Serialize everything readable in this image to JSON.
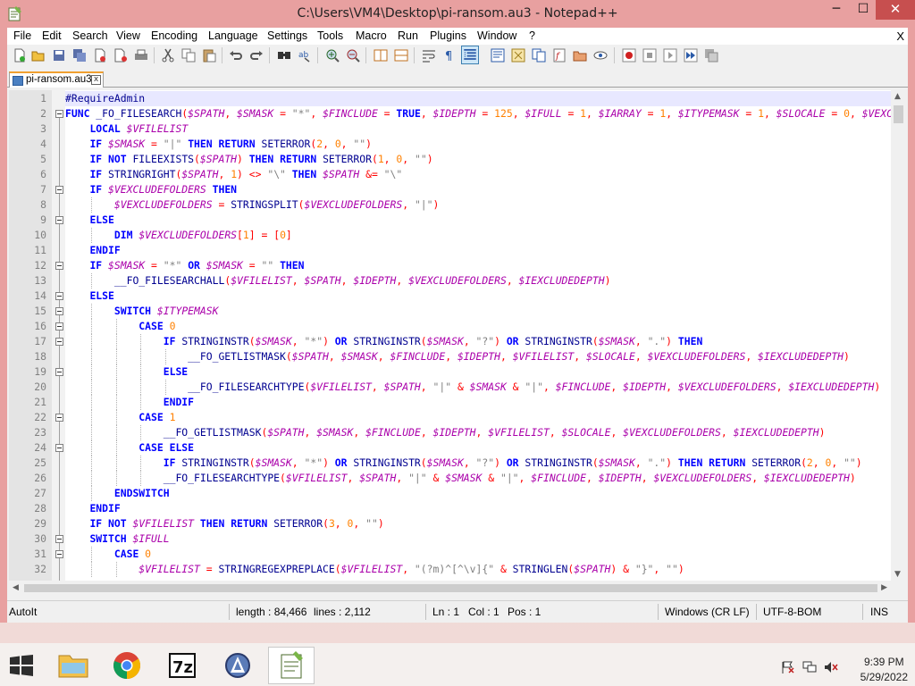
{
  "window": {
    "title": "C:\\Users\\VM4\\Desktop\\pi-ransom.au3 - Notepad++",
    "minimize": "─",
    "maximize": "☐",
    "close": "✕"
  },
  "menu": {
    "items": [
      "File",
      "Edit",
      "Search",
      "View",
      "Encoding",
      "Language",
      "Settings",
      "Tools",
      "Macro",
      "Run",
      "Plugins",
      "Window",
      "?"
    ],
    "close": "X"
  },
  "tab": {
    "label": "pi-ransom.au3",
    "close": "x"
  },
  "editor": {
    "current_line": 1,
    "line_numbers": [
      "1",
      "2",
      "3",
      "4",
      "5",
      "6",
      "7",
      "8",
      "9",
      "10",
      "11",
      "12",
      "13",
      "14",
      "15",
      "16",
      "17",
      "18",
      "19",
      "20",
      "21",
      "22",
      "23",
      "24",
      "25",
      "26",
      "27",
      "28",
      "29",
      "30",
      "31",
      "32"
    ]
  },
  "status": {
    "language": "AutoIt",
    "length": "length : 84,466",
    "lines": "lines : 2,112",
    "ln": "Ln : 1",
    "col": "Col : 1",
    "pos": "Pos : 1",
    "eol": "Windows (CR LF)",
    "encoding": "UTF-8-BOM",
    "mode": "INS"
  },
  "taskbar": {
    "time": "9:39 PM",
    "date": "5/29/2022"
  },
  "colors": {
    "title_bar": "#e8a0a0",
    "keyword": "#0000ff",
    "variable": "#aa00aa",
    "number": "#ff8000",
    "string": "#808080"
  }
}
